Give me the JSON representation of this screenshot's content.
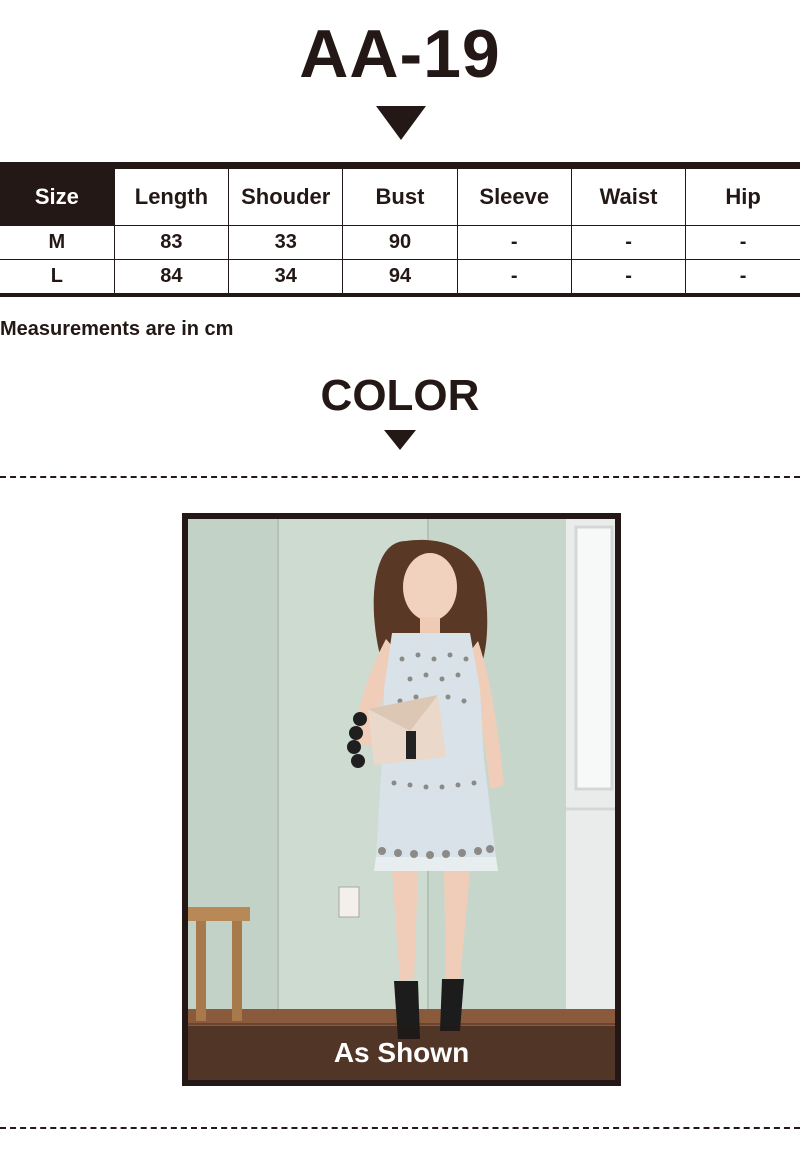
{
  "product_code": "AA-19",
  "size_table": {
    "headers": [
      "Size",
      "Length",
      "Shouder",
      "Bust",
      "Sleeve",
      "Waist",
      "Hip"
    ],
    "rows": [
      [
        "M",
        "83",
        "33",
        "90",
        "-",
        "-",
        "-"
      ],
      [
        "L",
        "84",
        "34",
        "94",
        "-",
        "-",
        "-"
      ]
    ]
  },
  "measurement_note": "Measurements are in cm",
  "color_heading": "COLOR",
  "color_option": {
    "caption": "As Shown"
  },
  "colors": {
    "ink": "#231815",
    "background": "#ffffff",
    "wall": "#c9d7cd",
    "dress": "#d8e2e8"
  }
}
